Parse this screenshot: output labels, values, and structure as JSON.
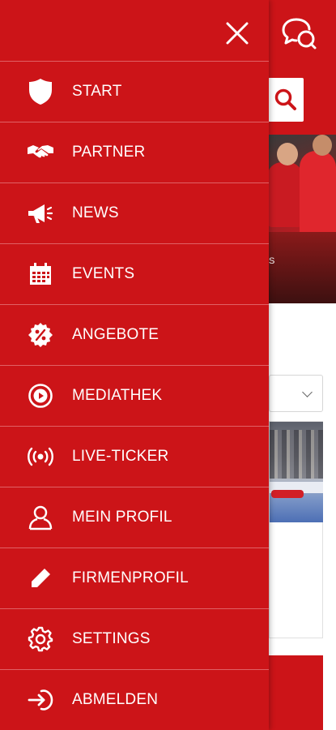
{
  "drawer": {
    "close_icon": "close-icon",
    "items": [
      {
        "label": "START",
        "icon": "shield-icon"
      },
      {
        "label": "PARTNER",
        "icon": "handshake-icon"
      },
      {
        "label": "NEWS",
        "icon": "megaphone-icon"
      },
      {
        "label": "EVENTS",
        "icon": "calendar-icon"
      },
      {
        "label": "ANGEBOTE",
        "icon": "percent-badge-icon"
      },
      {
        "label": "MEDIATHEK",
        "icon": "play-circle-icon"
      },
      {
        "label": "LIVE-TICKER",
        "icon": "broadcast-icon"
      },
      {
        "label": "MEIN PROFIL",
        "icon": "user-icon"
      },
      {
        "label": "FIRMENPROFIL",
        "icon": "pencil-icon"
      },
      {
        "label": "SETTINGS",
        "icon": "gear-icon"
      },
      {
        "label": "ABMELDEN",
        "icon": "logout-icon"
      }
    ]
  },
  "background": {
    "chat_icon": "chat-bubbles-icon",
    "search_icon": "search-icon",
    "hero_caption": "S"
  },
  "colors": {
    "brand_red": "#cc1418",
    "divider": "#e06165",
    "text": "#ffffff"
  }
}
